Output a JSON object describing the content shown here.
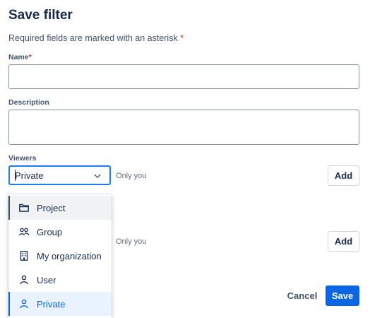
{
  "dialog": {
    "title": "Save filter",
    "required_note": "Required fields are marked with an asterisk",
    "asterisk": "*"
  },
  "fields": {
    "name_label": "Name",
    "name_value": "",
    "description_label": "Description",
    "description_value": "",
    "viewers_label": "Viewers"
  },
  "viewers": {
    "selected_value": "Private",
    "row1_note": "Only you",
    "row2_note": "Only you",
    "add_label": "Add"
  },
  "dropdown": {
    "options": [
      {
        "label": "Project",
        "icon": "folder-icon",
        "state": "hover"
      },
      {
        "label": "Group",
        "icon": "people-icon",
        "state": ""
      },
      {
        "label": "My organization",
        "icon": "building-icon",
        "state": ""
      },
      {
        "label": "User",
        "icon": "person-icon",
        "state": ""
      },
      {
        "label": "Private",
        "icon": "person-icon",
        "state": "selected"
      }
    ]
  },
  "footer": {
    "cancel_label": "Cancel",
    "save_label": "Save"
  },
  "colors": {
    "primary": "#0c66e4",
    "required": "#c9372c",
    "focus": "#1d7afc"
  }
}
